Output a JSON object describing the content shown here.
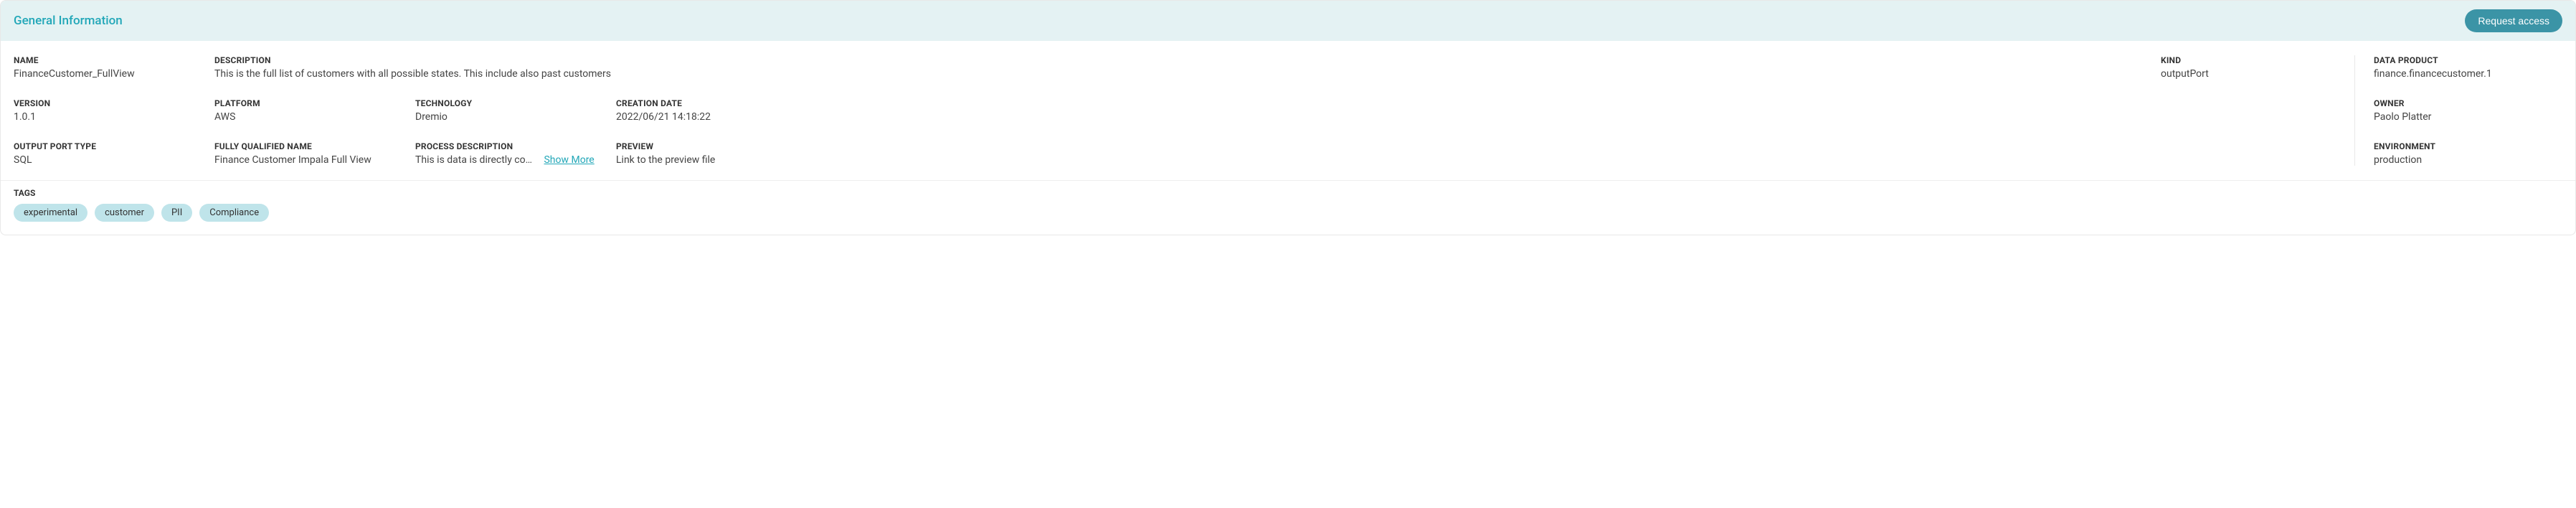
{
  "header": {
    "title": "General Information",
    "request_access_label": "Request access"
  },
  "fields": {
    "name": {
      "label": "NAME",
      "value": "FinanceCustomer_FullView"
    },
    "description": {
      "label": "DESCRIPTION",
      "value": "This is the full list of customers with all possible states. This include also past customers"
    },
    "kind": {
      "label": "KIND",
      "value": "outputPort"
    },
    "data_product": {
      "label": "DATA PRODUCT",
      "value": "finance.financecustomer.1"
    },
    "version": {
      "label": "VERSION",
      "value": "1.0.1"
    },
    "platform": {
      "label": "PLATFORM",
      "value": "AWS"
    },
    "technology": {
      "label": "TECHNOLOGY",
      "value": "Dremio"
    },
    "creation_date": {
      "label": "CREATION DATE",
      "value": "2022/06/21 14:18:22"
    },
    "owner": {
      "label": "OWNER",
      "value": "Paolo Platter"
    },
    "output_port_type": {
      "label": "OUTPUT PORT TYPE",
      "value": "SQL"
    },
    "fully_qualified_name": {
      "label": "FULLY QUALIFIED NAME",
      "value": "Finance Customer Impala Full View"
    },
    "process_description": {
      "label": "PROCESS DESCRIPTION",
      "value": "This is data is directly comin…",
      "show_more": "Show More"
    },
    "preview": {
      "label": "PREVIEW",
      "value": "Link to the preview file"
    },
    "environment": {
      "label": "ENVIRONMENT",
      "value": "production"
    }
  },
  "tags": {
    "label": "TAGS",
    "items": [
      "experimental",
      "customer",
      "PII",
      "Compliance"
    ]
  }
}
